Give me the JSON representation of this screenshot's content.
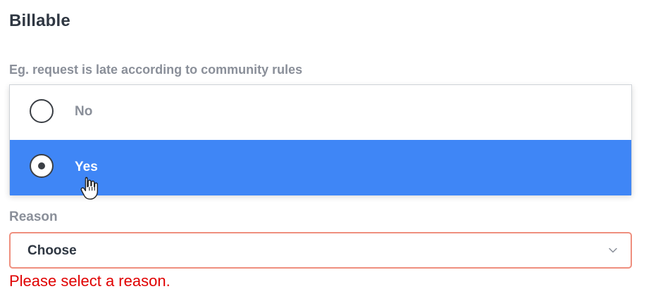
{
  "section": {
    "title": "Billable",
    "hint": "Eg. request is late according to community rules"
  },
  "billable_options": {
    "items": [
      {
        "label": "No",
        "selected": false,
        "highlighted": false
      },
      {
        "label": "Yes",
        "selected": true,
        "highlighted": true
      }
    ]
  },
  "reason": {
    "label": "Reason",
    "selected_value": "Choose",
    "error": "Please select a reason."
  },
  "colors": {
    "highlight": "#3f86f6",
    "error": "#e00000",
    "error_border": "#ef8f7e"
  },
  "icons": {
    "cursor": "hand-pointer-icon",
    "select_arrow": "chevron-down-icon"
  }
}
